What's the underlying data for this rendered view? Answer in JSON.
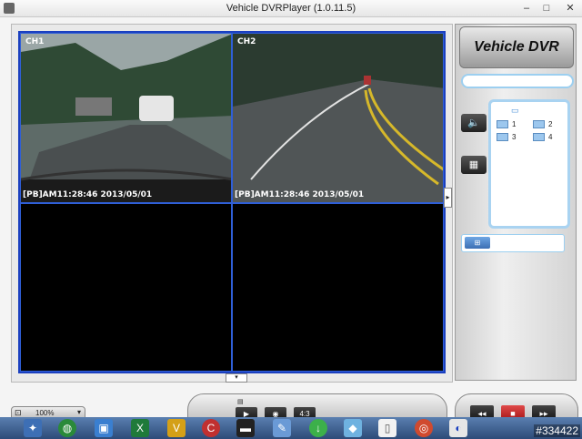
{
  "window": {
    "title": "Vehicle DVRPlayer (1.0.11.5)",
    "minimize_label": "–",
    "maximize_label": "□",
    "close_label": "✕"
  },
  "channels": [
    {
      "label": "CH1",
      "timestamp": "[PB]AM11:28:46 2013/05/01"
    },
    {
      "label": "CH2",
      "timestamp": "[PB]AM11:28:46 2013/05/01"
    }
  ],
  "right_panel": {
    "brand": "Vehicle DVR",
    "channel_items": [
      "1",
      "2",
      "3",
      "4"
    ]
  },
  "controls": {
    "zoom": "100%",
    "ratio": "4:3"
  },
  "taskbar": {
    "icons": [
      "start-icon",
      "wizard-icon",
      "windows-icon",
      "remote-icon",
      "excel-icon",
      "v-app-icon",
      "ccleaner-icon",
      "terminal-icon",
      "paint-icon",
      "download-icon",
      "calculator-icon",
      "document-icon",
      "chrome-icon",
      "dvr-player-icon"
    ]
  },
  "watermark": "#334422",
  "colors": {
    "grid_border": "#1a3fbf",
    "accent": "#a9d3f1",
    "stop": "#c02020"
  }
}
